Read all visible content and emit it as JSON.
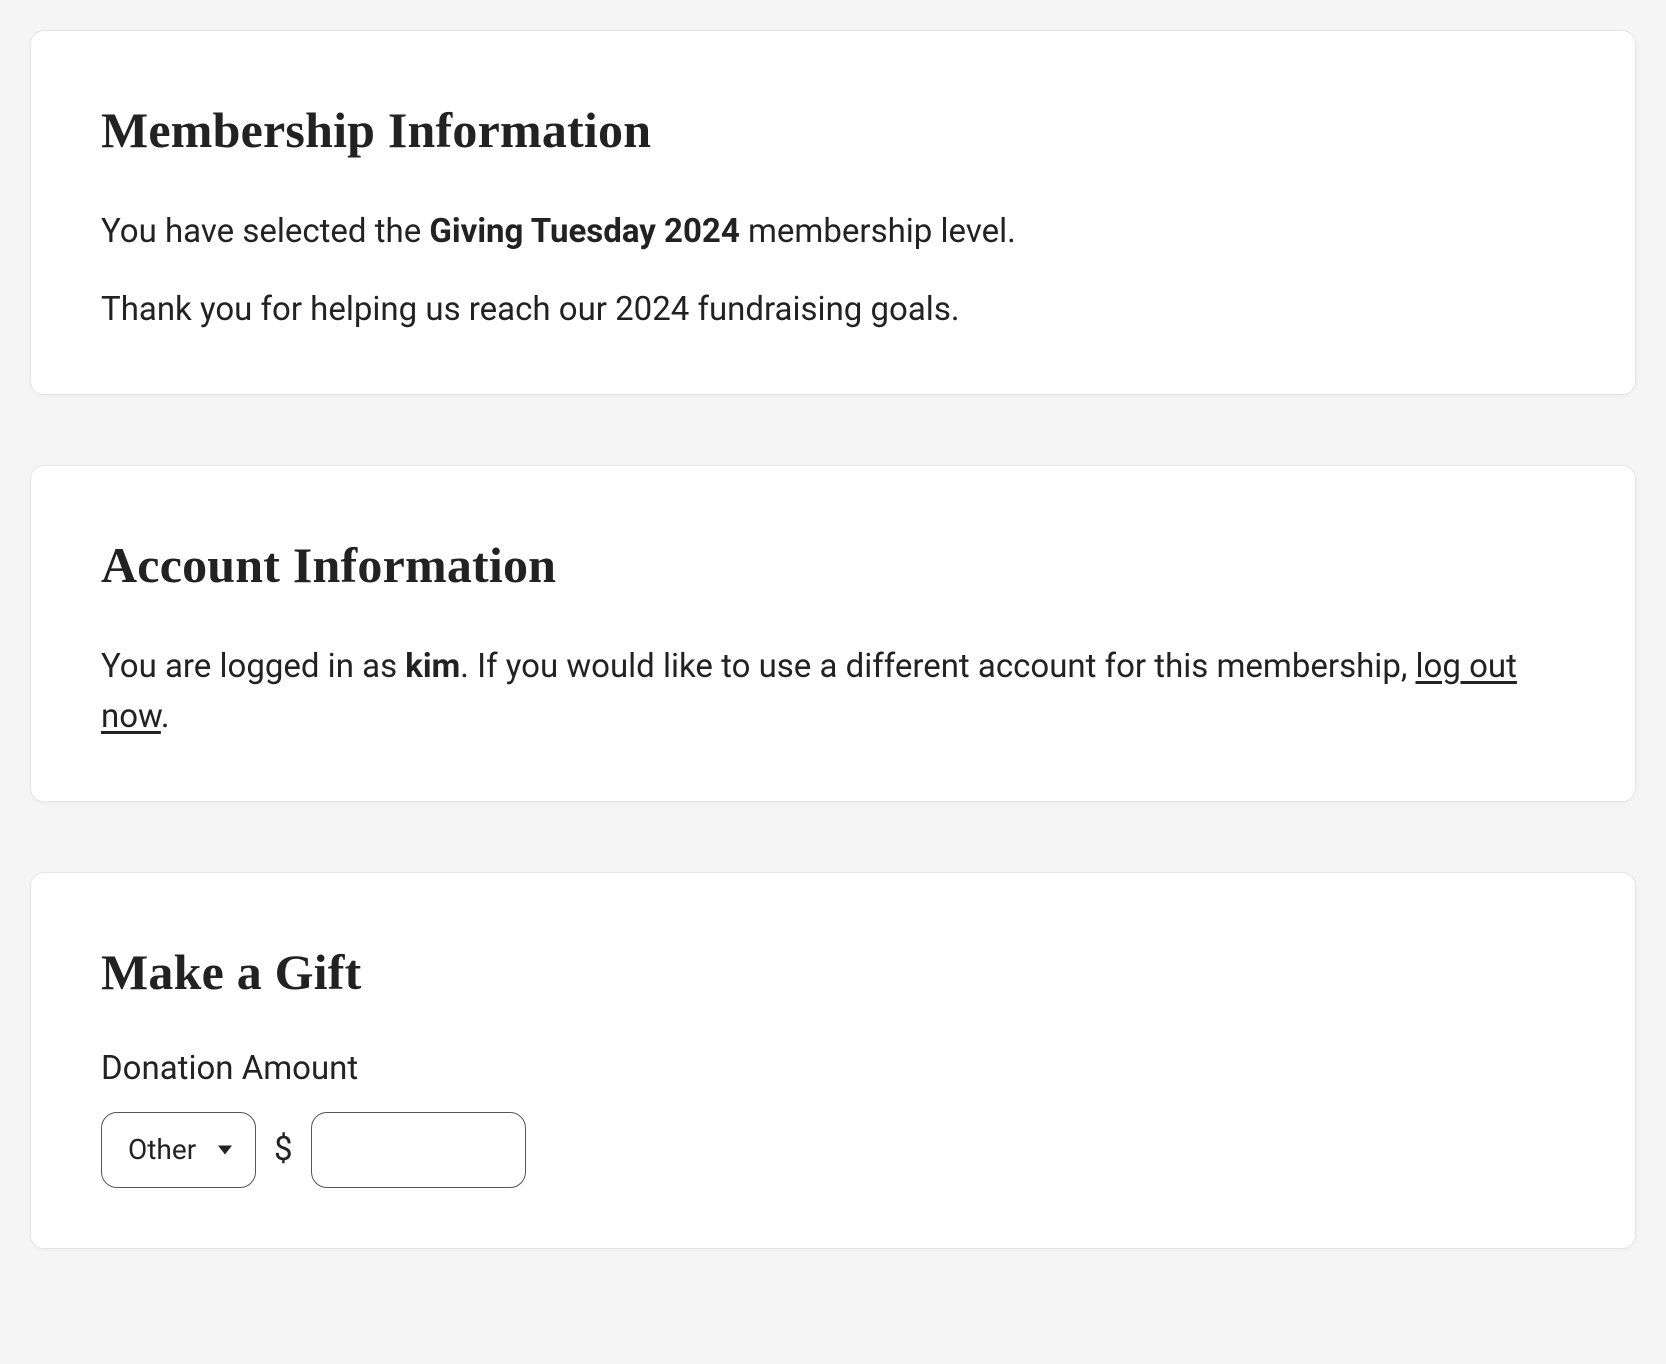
{
  "membership": {
    "title": "Membership Information",
    "prefix": "You have selected the ",
    "level_name": "Giving Tuesday 2024",
    "suffix": " membership level.",
    "thanks": "Thank you for helping us reach our 2024 fundraising goals."
  },
  "account": {
    "title": "Account Information",
    "logged_in_prefix": "You are logged in as ",
    "username": "kim",
    "logged_in_mid": ". If you would like to use a different account for this membership, ",
    "logout_link_text": "log out now",
    "logged_in_suffix": "."
  },
  "gift": {
    "title": "Make a Gift",
    "amount_label": "Donation Amount",
    "select_value": "Other",
    "currency_symbol": "$",
    "amount_value": ""
  }
}
